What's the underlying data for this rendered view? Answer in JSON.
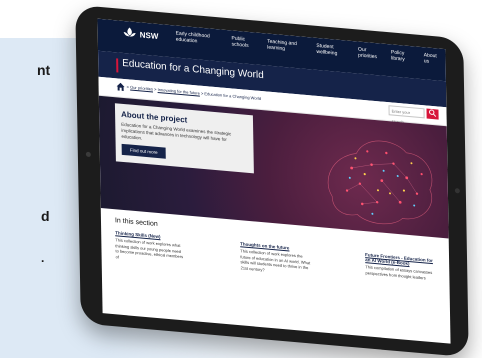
{
  "background_text": {
    "edge_top": "nt",
    "edge_mid": "d",
    "edge_low": "."
  },
  "logo": "NSW",
  "nav": {
    "items": [
      "Early childhood education",
      "Public schools",
      "Teaching and learning",
      "Student wellbeing",
      "Our priorities",
      "Policy library",
      "About us"
    ]
  },
  "title_bar": {
    "title": "Education for a Changing World"
  },
  "breadcrumb": {
    "parts": [
      "Our priorities",
      "Innovating for the future",
      "Education for a Changing World"
    ],
    "separator": ">"
  },
  "search": {
    "placeholder": "Enter your search..."
  },
  "hero": {
    "heading": "About the project",
    "description": "Education for a Changing World examines the strategic implications that advances in technology will have for education.",
    "button_label": "Find out more"
  },
  "section": {
    "heading": "In this section",
    "items": [
      {
        "title": "Thinking Skills (New)",
        "desc": "This collection of work explores what thinking skills our young people need to become proactive, ethical members of"
      },
      {
        "title": "Thoughts on the future",
        "desc": "This collection of work explores the future of education in an AI world. What skills will students need to thrive in the 21st century?"
      },
      {
        "title": "Future Frontiers - Education for an AI World (e-Book)",
        "desc": "This compilation of essays canvasses perspectives from thought leaders"
      }
    ]
  },
  "colors": {
    "navy": "#0b1a3b",
    "title_bar": "#152349",
    "accent_red": "#d7153a",
    "hero_purple": "#4b1e3e"
  },
  "icons": [
    "home-icon",
    "search-icon",
    "camera-icon"
  ]
}
